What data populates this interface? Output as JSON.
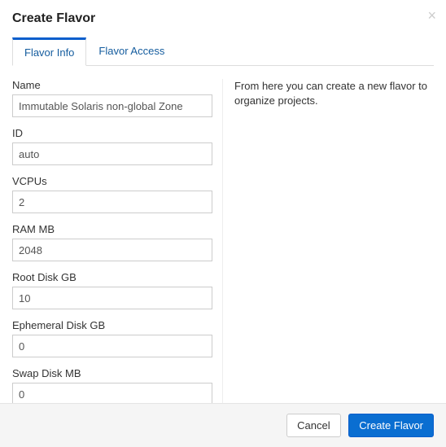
{
  "header": {
    "title": "Create Flavor"
  },
  "tabs": {
    "info": "Flavor Info",
    "access": "Flavor Access"
  },
  "form": {
    "name_label": "Name",
    "name_value": "Immutable Solaris non-global Zone",
    "id_label": "ID",
    "id_value": "auto",
    "vcpus_label": "VCPUs",
    "vcpus_value": "2",
    "ram_label": "RAM MB",
    "ram_value": "2048",
    "rootdisk_label": "Root Disk GB",
    "rootdisk_value": "10",
    "ephemeral_label": "Ephemeral Disk GB",
    "ephemeral_value": "0",
    "swap_label": "Swap Disk MB",
    "swap_value": "0"
  },
  "help": {
    "text": "From here you can create a new flavor to organize projects."
  },
  "footer": {
    "cancel": "Cancel",
    "submit": "Create Flavor"
  }
}
